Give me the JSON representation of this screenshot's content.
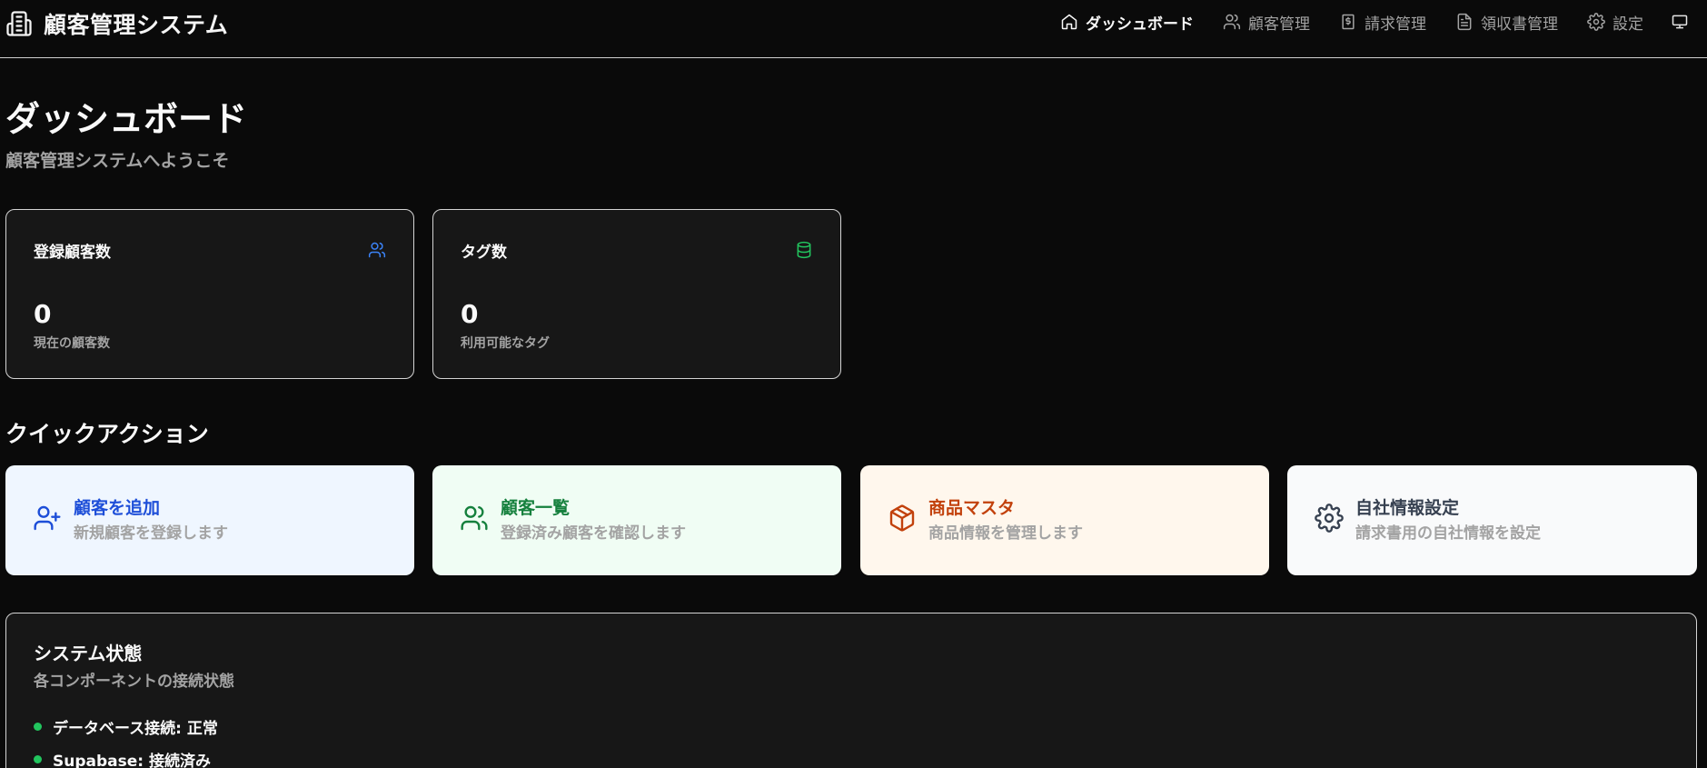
{
  "app": {
    "title": "顧客管理システム"
  },
  "nav": [
    {
      "label": "ダッシュボード",
      "icon": "home-icon",
      "active": true
    },
    {
      "label": "顧客管理",
      "icon": "users-icon"
    },
    {
      "label": "請求管理",
      "icon": "dollar-file-icon"
    },
    {
      "label": "領収書管理",
      "icon": "file-text-icon"
    },
    {
      "label": "設定",
      "icon": "gear-icon"
    }
  ],
  "page": {
    "title": "ダッシュボード",
    "subtitle": "顧客管理システムへようこそ"
  },
  "stats": [
    {
      "label": "登録顧客数",
      "value": "0",
      "desc": "現在の顧客数",
      "icon": "users-icon",
      "icon_color": "#3b82f6"
    },
    {
      "label": "タグ数",
      "value": "0",
      "desc": "利用可能なタグ",
      "icon": "database-icon",
      "icon_color": "#22c55e"
    }
  ],
  "quick_actions": {
    "title": "クイックアクション",
    "items": [
      {
        "title": "顧客を追加",
        "desc": "新規顧客を登録します",
        "icon": "user-plus-icon",
        "bg": "#eff6ff",
        "color": "#1d4ed8"
      },
      {
        "title": "顧客一覧",
        "desc": "登録済み顧客を確認します",
        "icon": "users-icon",
        "bg": "#f0fdf4",
        "color": "#15803d"
      },
      {
        "title": "商品マスタ",
        "desc": "商品情報を管理します",
        "icon": "package-icon",
        "bg": "#fff7ed",
        "color": "#c2410c"
      },
      {
        "title": "自社情報設定",
        "desc": "請求書用の自社情報を設定",
        "icon": "gear-icon",
        "bg": "#f9fafb",
        "color": "#374151"
      }
    ]
  },
  "system": {
    "title": "システム状態",
    "subtitle": "各コンポーネントの接続状態",
    "items": [
      {
        "text": "データベース接続: 正常",
        "status_color": "#22c55e"
      },
      {
        "text": "Supabase: 接続済み",
        "status_color": "#22c55e"
      }
    ]
  }
}
